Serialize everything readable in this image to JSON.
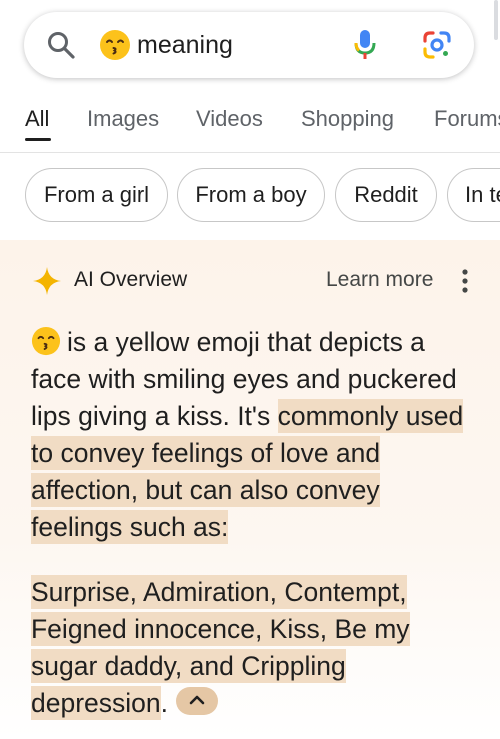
{
  "search": {
    "query_emoji": "kissing-face-with-smiling-eyes",
    "query_text": "meaning",
    "icons": [
      "search-icon",
      "microphone-icon",
      "google-lens-icon"
    ]
  },
  "tabs": [
    {
      "label": "All",
      "active": true
    },
    {
      "label": "Images",
      "active": false
    },
    {
      "label": "Videos",
      "active": false
    },
    {
      "label": "Shopping",
      "active": false
    },
    {
      "label": "Forums",
      "active": false
    }
  ],
  "chips": [
    "From a girl",
    "From a boy",
    "Reddit",
    "In text"
  ],
  "ai_overview": {
    "title": "AI Overview",
    "learn_more": "Learn more",
    "paragraph1_plain": "is a yellow emoji that depicts a face with smiling eyes and puckered lips giving a kiss. It's",
    "paragraph1_highlight": "commonly used to convey feelings of love and affection, but can also convey feelings such as:",
    "paragraph2_highlight": "Surprise, Admiration, Contempt, Feigned innocence, Kiss, Be my sugar daddy, and Crippling depression",
    "paragraph2_end": ".",
    "highlight_color": "#f1dcc4",
    "accent_color": "#f4b400"
  }
}
